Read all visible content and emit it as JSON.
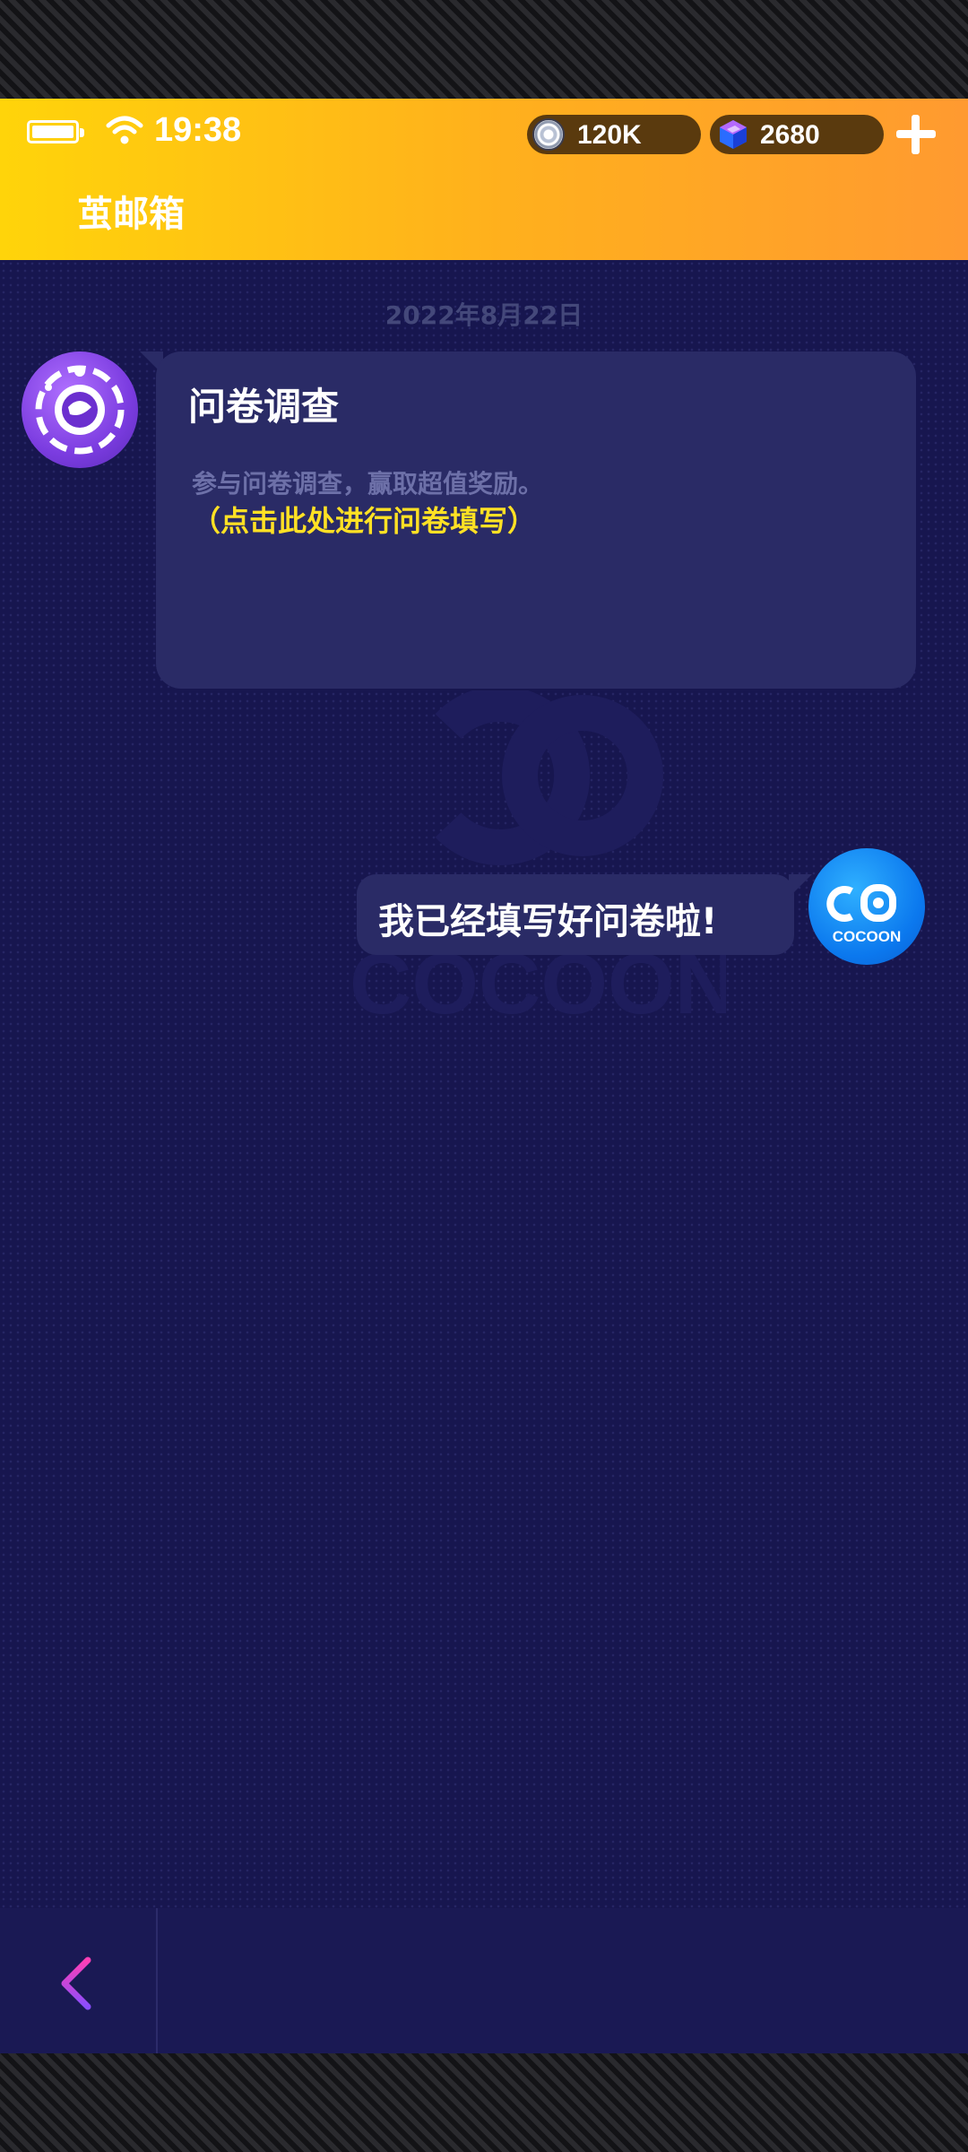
{
  "status_bar": {
    "time": "19:38"
  },
  "currency": {
    "coins": "120K",
    "gems": "2680"
  },
  "header": {
    "title": "茧邮箱"
  },
  "conversation": {
    "date": "2022年8月22日",
    "mail": {
      "title": "问卷调查",
      "body": "参与问卷调查，赢取超值奖励。",
      "link_text": "（点击此处进行问卷填写）"
    },
    "reply": {
      "text": "我已经填写好问卷啦!"
    }
  },
  "brand": {
    "logo_text": "COCOON",
    "colors": {
      "header_start": "#ffd40a",
      "header_end": "#ff9a30",
      "background": "#17164f",
      "bubble": "#2a2b66",
      "link": "#ffe124",
      "back_arrow_start": "#ff3fb5",
      "back_arrow_end": "#8a4dff"
    }
  },
  "icons": {
    "battery": "battery-icon",
    "wifi": "wifi-icon",
    "coin": "coin-icon",
    "gem": "gem-icon",
    "plus": "plus-icon",
    "back": "chevron-left-icon"
  }
}
